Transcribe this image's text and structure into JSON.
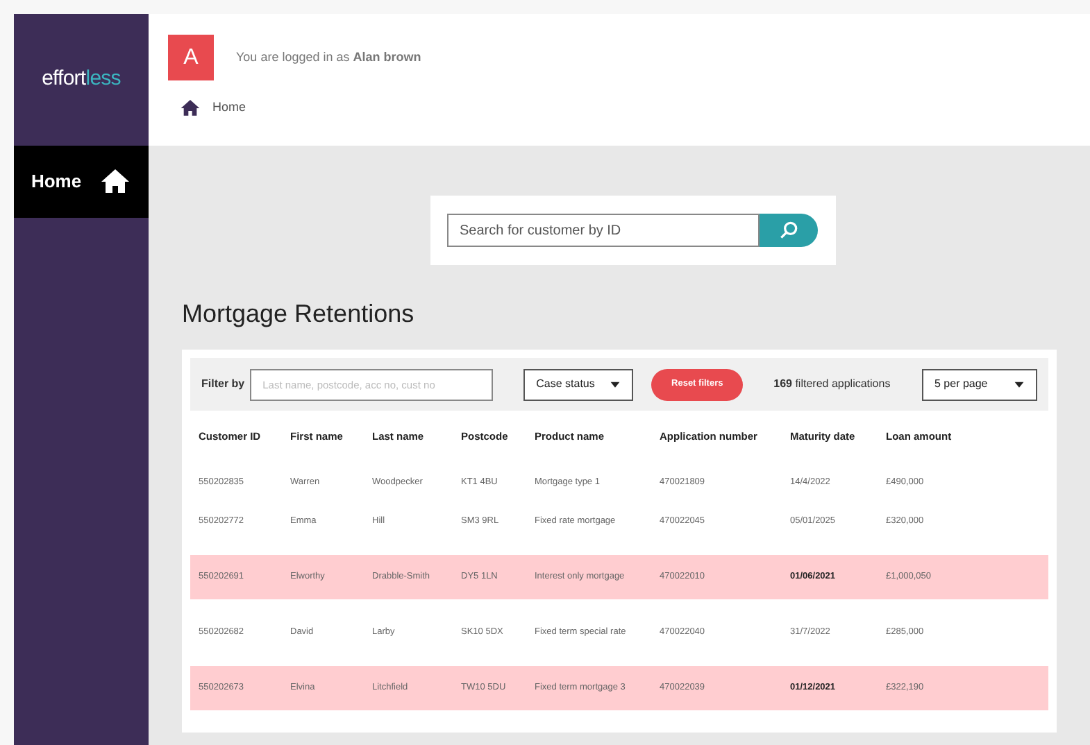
{
  "logo": {
    "part_1": "effort",
    "part_2": "less"
  },
  "sidebar": {
    "items": [
      {
        "label": "Home",
        "selected": true
      }
    ]
  },
  "header": {
    "avatar": "A",
    "login_text": "You are logged in as **Alan brown**"
  },
  "breadcrumb": {
    "label": "Home"
  },
  "search": {
    "placeholder": "Search for customer by ID"
  },
  "page_title": "Mortgage Retentions",
  "filters": {
    "label": "Filter by",
    "placeholder": "Last name, postcode, acc no, cust no",
    "status_select": "Case status",
    "reset_button": "Reset filters",
    "count_text": "**169** filtered applications",
    "page_size_select": "5 per page"
  },
  "table": {
    "columns": [
      "Customer ID",
      "First name",
      "Last name",
      "Postcode",
      "Product name",
      "Application number",
      "Maturity date",
      "Loan amount"
    ],
    "rows": [
      {
        "flagged": false,
        "cells": [
          "550202835",
          "Warren",
          "Woodpecker",
          "KT1 4BU",
          "Mortgage type 1",
          "470021809",
          "14/4/2022",
          "£490,000"
        ]
      },
      {
        "flagged": false,
        "cells": [
          "550202772",
          "Emma",
          "Hill",
          "SM3 9RL",
          "Fixed rate mortgage",
          "470022045",
          "05/01/2025",
          "£320,000"
        ]
      },
      {
        "flagged": true,
        "cells": [
          "550202691",
          "Elworthy",
          "Drabble-Smith",
          "DY5 1LN",
          "Interest only mortgage",
          "470022010",
          "01/06/2021",
          "£1,000,050"
        ]
      },
      {
        "flagged": false,
        "cells": [
          "550202682",
          "David",
          "Larby",
          "SK10 5DX",
          "Fixed term special rate",
          "470022040",
          "31/7/2022",
          "£285,000"
        ]
      },
      {
        "flagged": true,
        "cells": [
          "550202673",
          "Elvina",
          "Litchfield",
          "TW10 5DU",
          "Fixed term mortgage 3",
          "470022039",
          "01/12/2021",
          "£322,190"
        ]
      }
    ]
  }
}
